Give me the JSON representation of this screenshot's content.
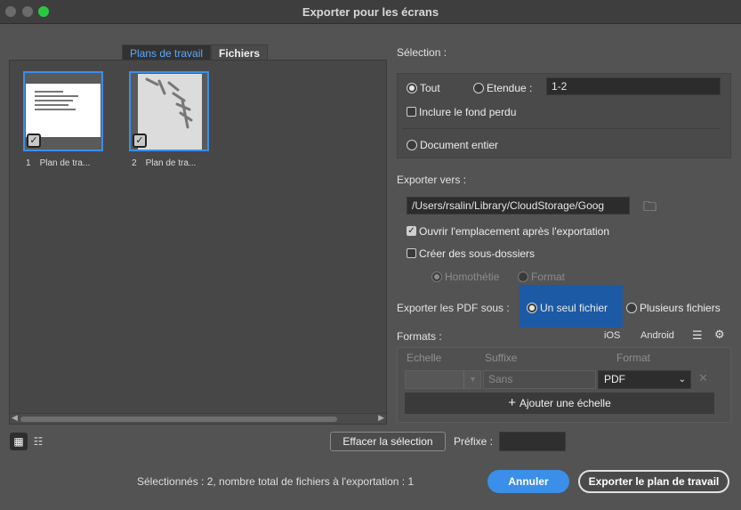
{
  "window": {
    "title": "Exporter pour les écrans"
  },
  "tabs": [
    {
      "label": "Plans de travail",
      "active": true
    },
    {
      "label": "Fichiers",
      "active": false
    }
  ],
  "artboards": [
    {
      "number": "1",
      "name": "Plan de tra...",
      "selected": true
    },
    {
      "number": "2",
      "name": "Plan de tra...",
      "selected": true
    }
  ],
  "selection": {
    "label": "Sélection :",
    "all": "Tout",
    "range": "Etendue :",
    "range_value": "1-2",
    "include_bleed": "Inclure le fond perdu",
    "whole_document": "Document entier"
  },
  "export_to": {
    "label": "Exporter vers :",
    "path": "/Users/rsalin/Library/CloudStorage/Goog",
    "open_after": "Ouvrir l'emplacement après l'exportation",
    "create_subfolders": "Créer des sous-dossiers",
    "homothetie": "Homothétie",
    "format_option": "Format"
  },
  "pdf_export": {
    "label": "Exporter les PDF sous :",
    "single": "Un seul fichier",
    "multiple": "Plusieurs fichiers"
  },
  "formats": {
    "label": "Formats :",
    "ios": "iOS",
    "android": "Android",
    "col_scale": "Echelle",
    "col_suffix": "Suffixe",
    "col_format": "Format",
    "suffix_placeholder": "Sans",
    "format_value": "PDF",
    "add_scale": "Ajouter une échelle"
  },
  "footer": {
    "clear_selection": "Effacer la sélection",
    "prefix_label": "Préfixe :",
    "status": "Sélectionnés : 2, nombre total de fichiers à l'exportation : 1",
    "cancel": "Annuler",
    "export": "Exporter le plan de travail"
  },
  "colors": {
    "accent": "#3b8fe8",
    "highlight": "#1c5aa6"
  }
}
